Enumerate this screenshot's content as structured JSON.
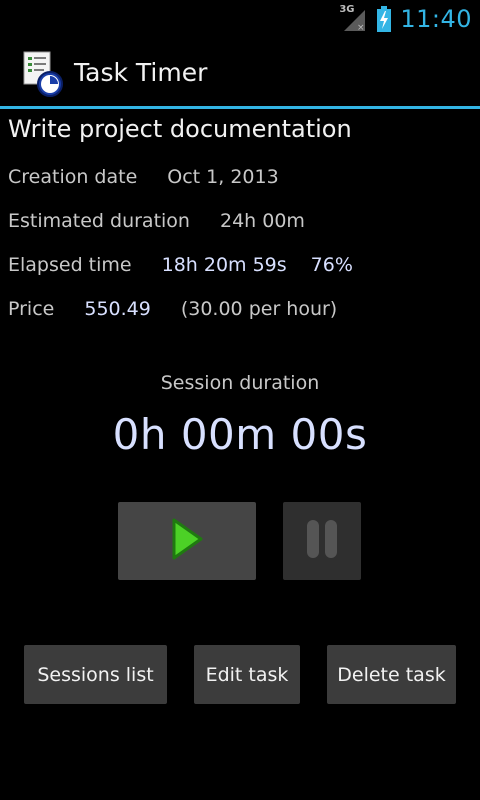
{
  "status_bar": {
    "network_label": "3G",
    "time": "11:40",
    "icons": [
      "signal-icon",
      "battery-charging-icon"
    ],
    "clock_color": "#33b5e5"
  },
  "action_bar": {
    "title": "Task Timer",
    "icon": "task-timer-app-icon",
    "divider_color": "#33b5e5"
  },
  "task": {
    "name": "Write project documentation",
    "creation_label": "Creation date",
    "creation_value": "Oct 1, 2013",
    "estimated_label": "Estimated duration",
    "estimated_value": "24h 00m",
    "elapsed_label": "Elapsed time",
    "elapsed_value": "18h 20m 59s",
    "elapsed_percent": "76%",
    "price_label": "Price",
    "price_value": "550.49",
    "price_rate": "(30.00 per hour)"
  },
  "session": {
    "label": "Session duration",
    "value": "0h 00m 00s"
  },
  "controls": {
    "play_icon": "play-icon",
    "pause_icon": "pause-icon",
    "play_color": "#4cd126",
    "pause_enabled": false
  },
  "buttons": {
    "sessions_list": "Sessions list",
    "edit_task": "Edit task",
    "delete_task": "Delete task"
  }
}
